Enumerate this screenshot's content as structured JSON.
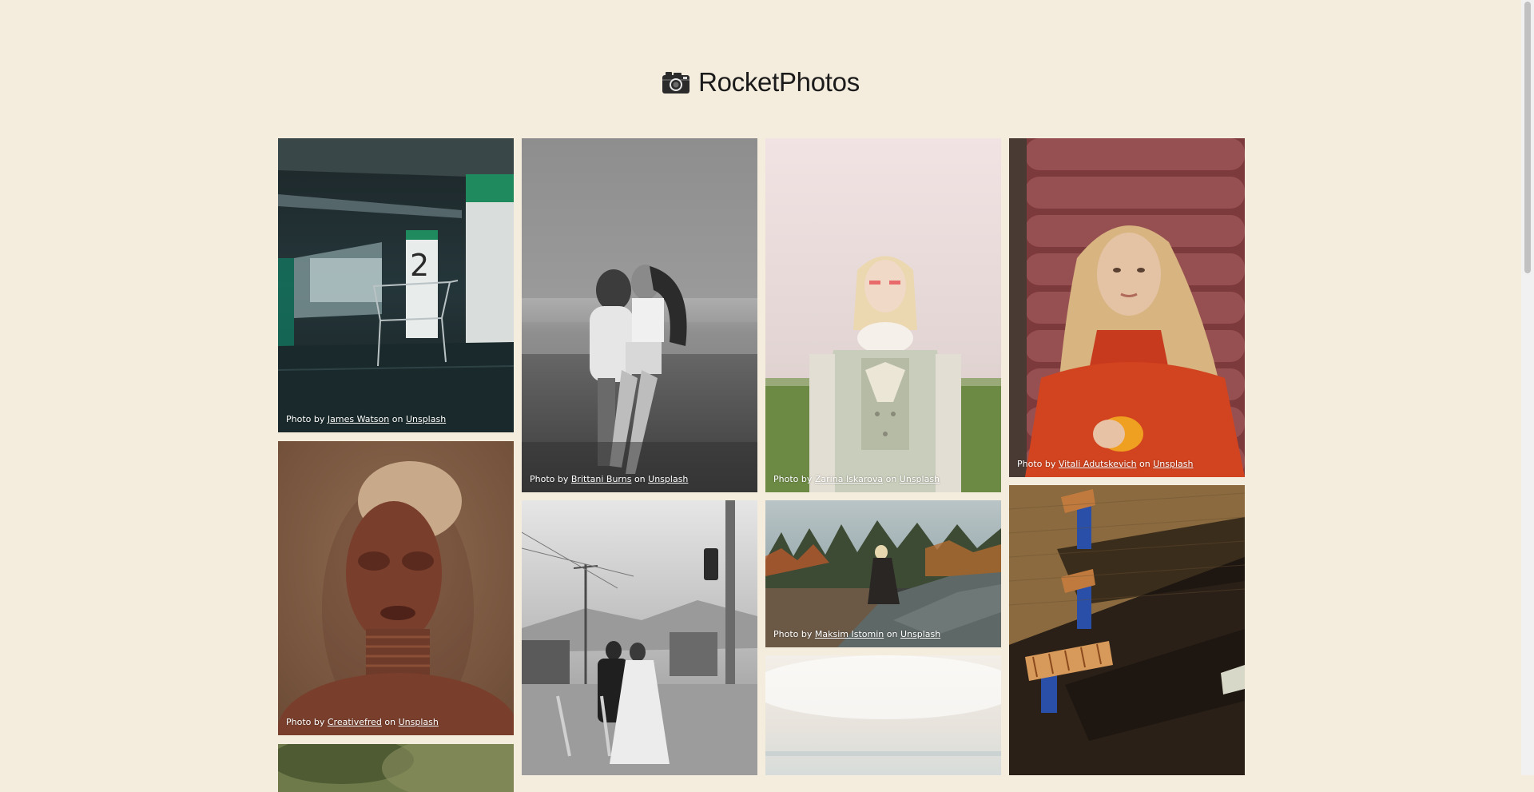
{
  "header": {
    "title": "RocketPhotos",
    "icon": "camera-icon"
  },
  "credit": {
    "prefix": "Photo by",
    "on": "on",
    "site": "Unsplash"
  },
  "photos": [
    {
      "author": "James Watson",
      "subject": "parking-garage-cart"
    },
    {
      "author": "Creativefred",
      "subject": "portrait-woman-cap"
    },
    {
      "author": "Brittani Burns",
      "subject": "couple-beach-bw"
    },
    {
      "author": "Zarina Iskarova",
      "subject": "woman-white-jacket"
    },
    {
      "author": "Maksim Istomin",
      "subject": "woman-rock-lake"
    },
    {
      "author": "Vitali Adutskevich",
      "subject": "woman-red-sweater"
    }
  ],
  "colors": {
    "background": "#f4ecdd",
    "text": "#1b1b1b",
    "credit": "#ffffff"
  }
}
